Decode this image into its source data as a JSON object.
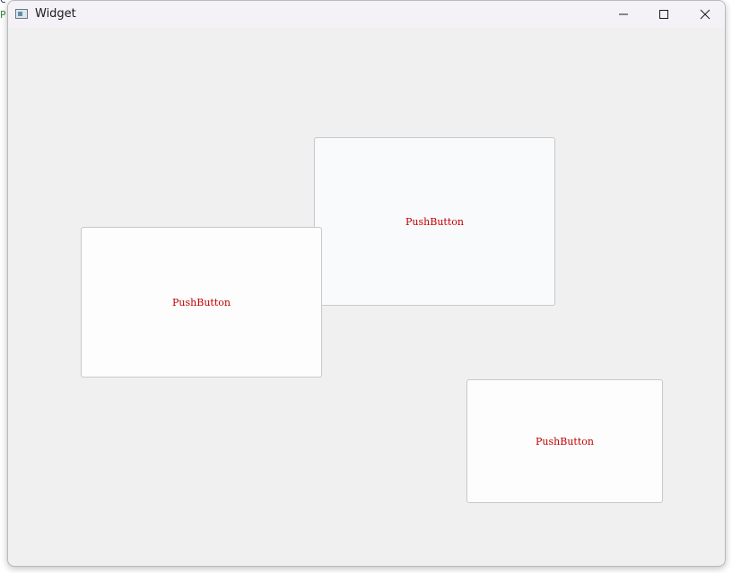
{
  "background_app": {
    "fragment_1": "C",
    "fragment_2": "P"
  },
  "window": {
    "title": "Widget",
    "controls": {
      "minimize": "minimize-icon",
      "maximize": "maximize-icon",
      "close": "close-icon"
    }
  },
  "buttons": [
    {
      "label": "PushButton"
    },
    {
      "label": "PushButton"
    },
    {
      "label": "PushButton"
    }
  ],
  "colors": {
    "button_text": "#c00000",
    "window_bg": "#f0f0f0",
    "titlebar_bg": "#f4f1f7"
  }
}
